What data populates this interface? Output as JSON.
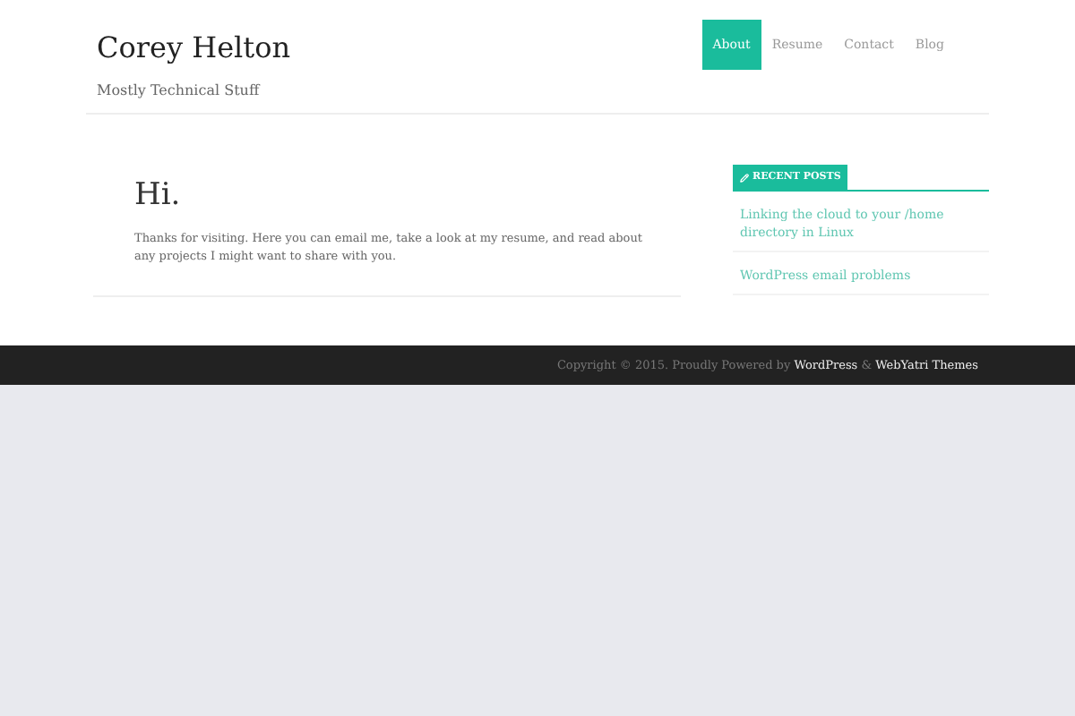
{
  "site": {
    "title": "Corey Helton",
    "tagline": "Mostly Technical Stuff"
  },
  "nav": [
    {
      "label": "About",
      "selected": true
    },
    {
      "label": "Resume",
      "selected": false
    },
    {
      "label": "Contact",
      "selected": false
    },
    {
      "label": "Blog",
      "selected": false
    }
  ],
  "page": {
    "heading": "Hi.",
    "body": "Thanks for visiting. Here you can email me, take a look at my resume, and read about any projects I might want to share with you."
  },
  "sidebar": {
    "widget_title": "RECENT POSTS",
    "posts": [
      "Linking the cloud to your /home directory in Linux",
      "WordPress email problems"
    ]
  },
  "footer": {
    "text": "Copyright © 2015. Proudly Powered by",
    "links": [
      "WordPress",
      "WebYatri Themes"
    ],
    "separator": "&"
  }
}
